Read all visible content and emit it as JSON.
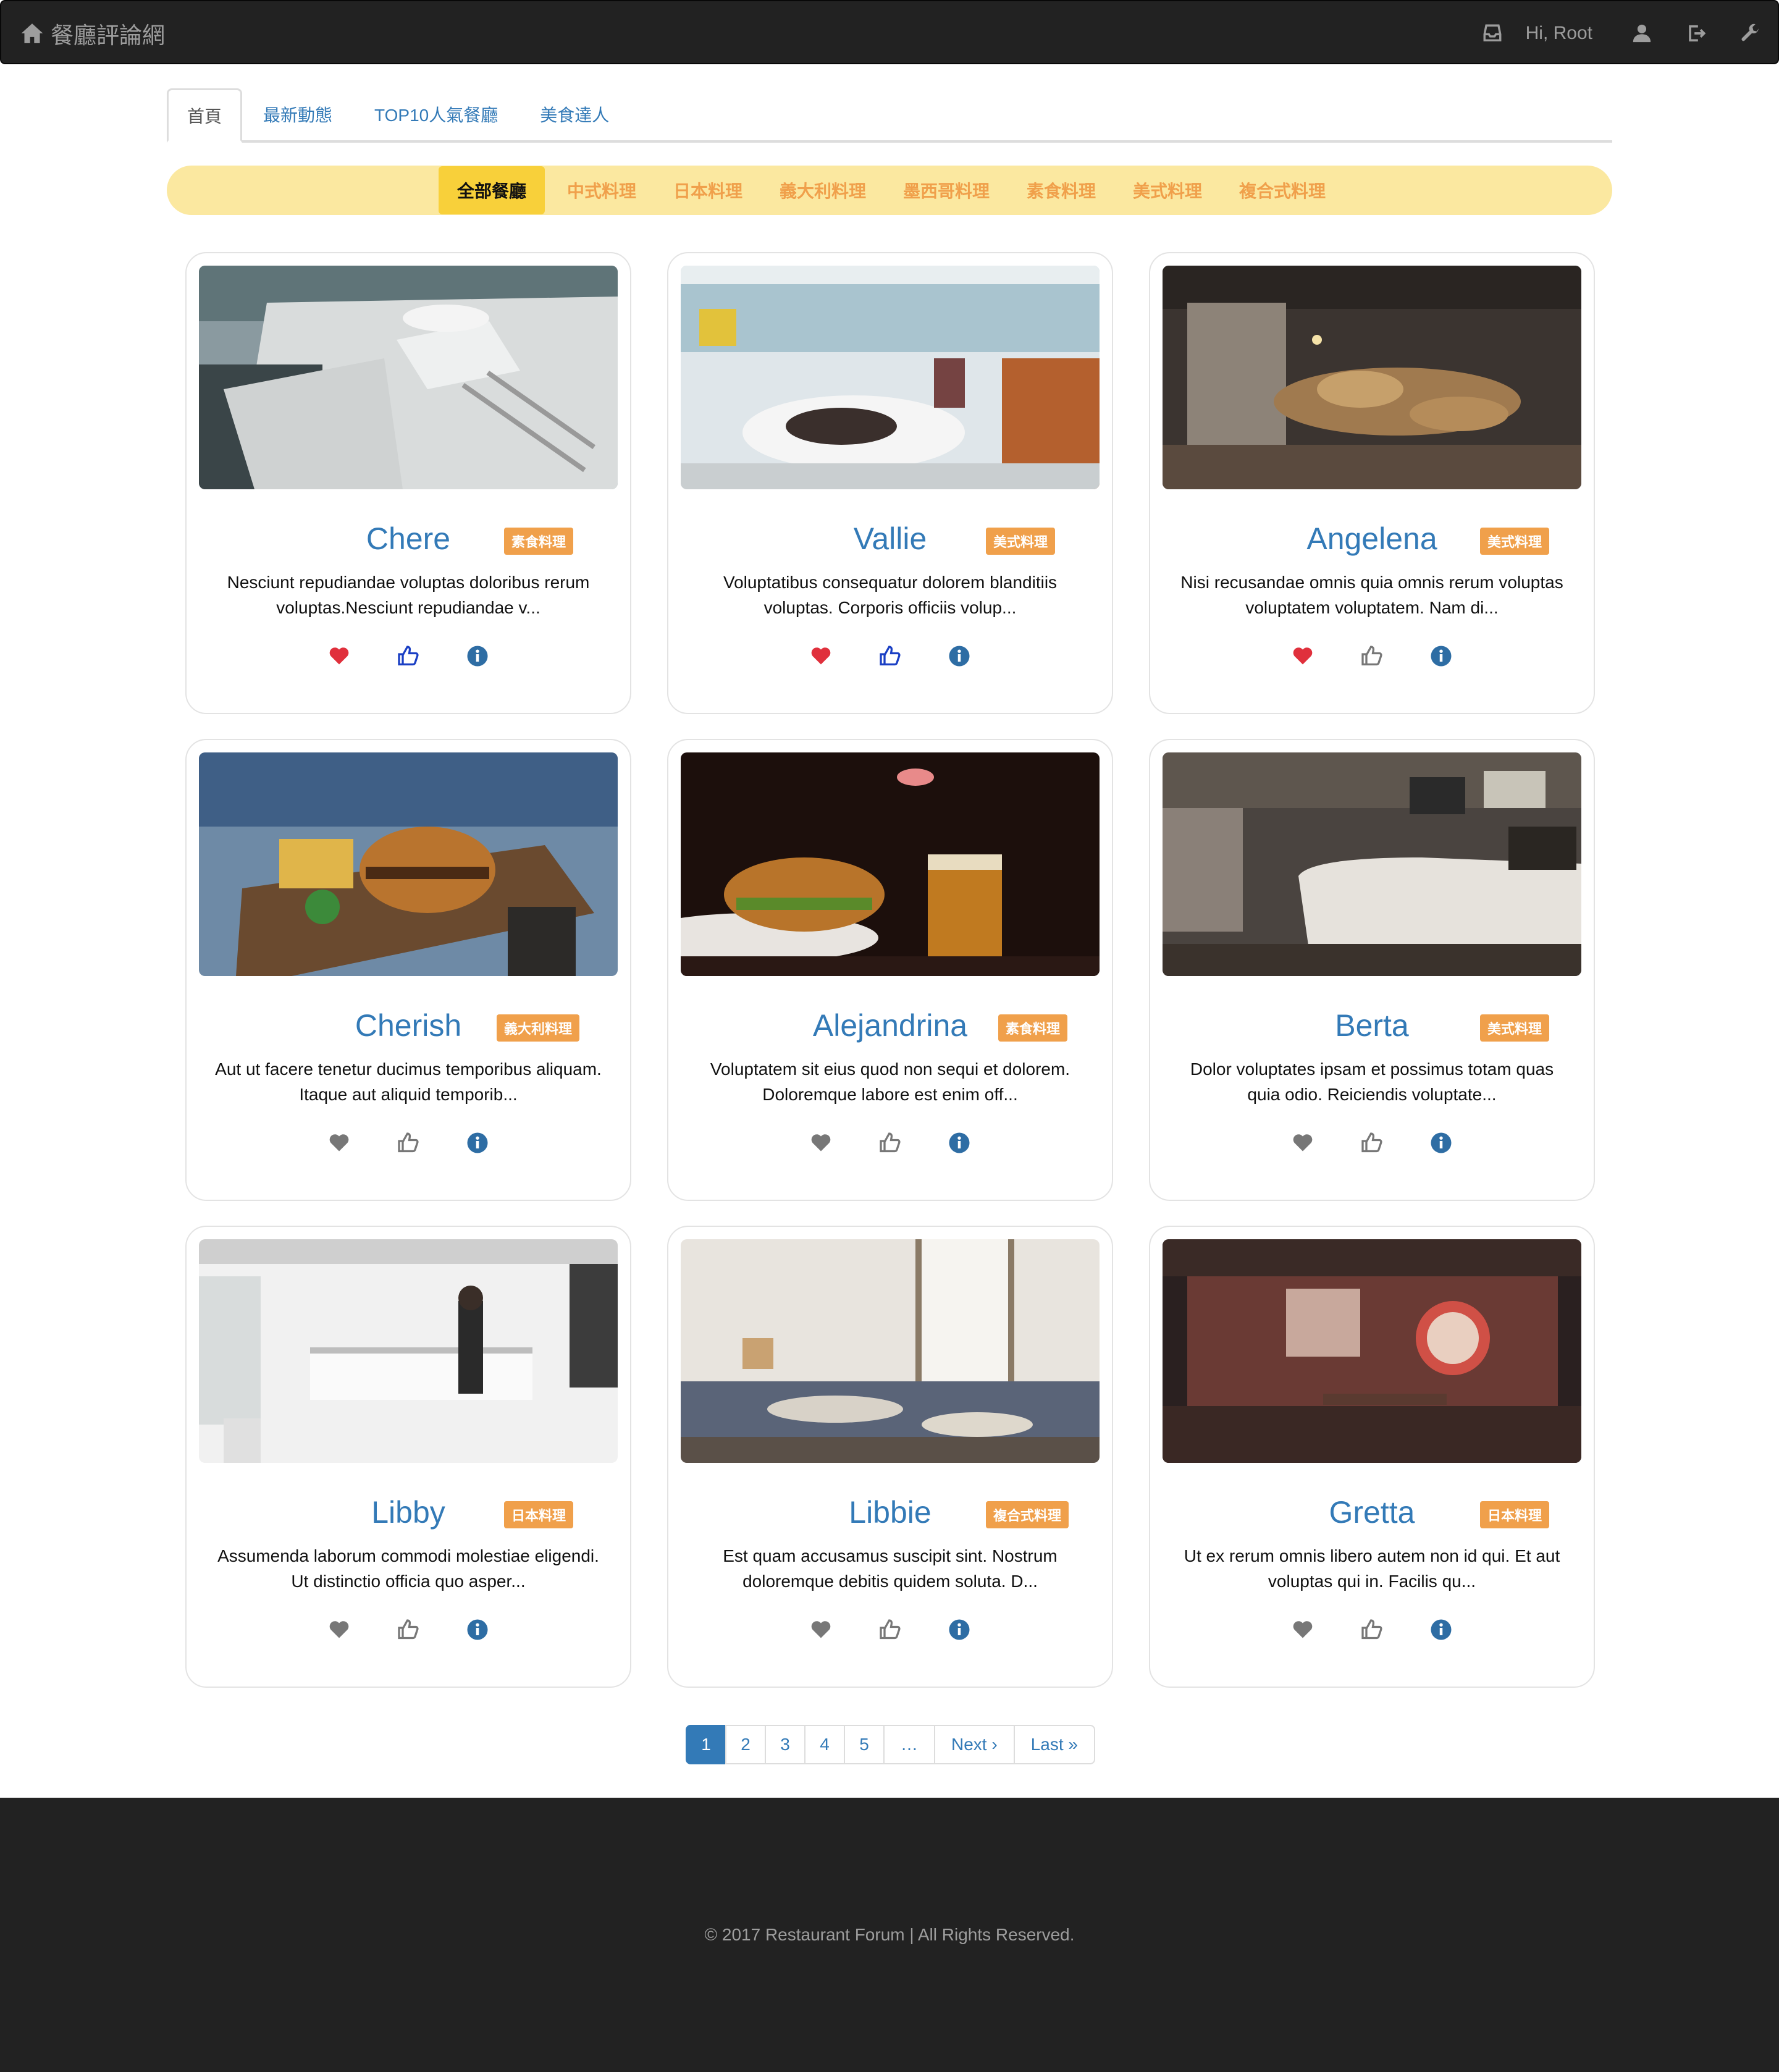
{
  "navbar": {
    "brand": "餐廳評論網",
    "greeting": "Hi, Root"
  },
  "tabs": [
    {
      "label": "首頁",
      "active": true
    },
    {
      "label": "最新動態",
      "active": false
    },
    {
      "label": "TOP10人氣餐廳",
      "active": false
    },
    {
      "label": "美食達人",
      "active": false
    }
  ],
  "categories": [
    {
      "label": "全部餐廳",
      "active": true
    },
    {
      "label": "中式料理",
      "active": false
    },
    {
      "label": "日本料理",
      "active": false
    },
    {
      "label": "義大利料理",
      "active": false
    },
    {
      "label": "墨西哥料理",
      "active": false
    },
    {
      "label": "素食料理",
      "active": false
    },
    {
      "label": "美式料理",
      "active": false
    },
    {
      "label": "複合式料理",
      "active": false
    }
  ],
  "restaurants": [
    {
      "name": "Chere",
      "category": "素食料理",
      "desc_line1": "Nesciunt repudiandae voluptas doloribus rerum",
      "desc_line2": "voluptas.Nesciunt repudiandae v...",
      "favorited": true,
      "liked": true
    },
    {
      "name": "Vallie",
      "category": "美式料理",
      "desc_line1": "Voluptatibus consequatur dolorem blanditiis",
      "desc_line2": "voluptas. Corporis officiis volup...",
      "favorited": true,
      "liked": true
    },
    {
      "name": "Angelena",
      "category": "美式料理",
      "desc_line1": "Nisi recusandae omnis quia omnis rerum voluptas",
      "desc_line2": "voluptatem voluptatem. Nam di...",
      "favorited": true,
      "liked": false
    },
    {
      "name": "Cherish",
      "category": "義大利料理",
      "desc_line1": "Aut ut facere tenetur ducimus temporibus aliquam.",
      "desc_line2": "Itaque aut aliquid temporib...",
      "favorited": false,
      "liked": false
    },
    {
      "name": "Alejandrina",
      "category": "素食料理",
      "desc_line1": "Voluptatem sit eius quod non sequi et dolorem.",
      "desc_line2": "Doloremque labore est enim off...",
      "favorited": false,
      "liked": false
    },
    {
      "name": "Berta",
      "category": "美式料理",
      "desc_line1": "Dolor voluptates ipsam et possimus totam quas",
      "desc_line2": "quia odio. Reiciendis voluptate...",
      "favorited": false,
      "liked": false
    },
    {
      "name": "Libby",
      "category": "日本料理",
      "desc_line1": "Assumenda laborum commodi molestiae eligendi.",
      "desc_line2": "Ut distinctio officia quo asper...",
      "favorited": false,
      "liked": false
    },
    {
      "name": "Libbie",
      "category": "複合式料理",
      "desc_line1": "Est quam accusamus suscipit sint. Nostrum",
      "desc_line2": "doloremque debitis quidem soluta. D...",
      "favorited": false,
      "liked": false
    },
    {
      "name": "Gretta",
      "category": "日本料理",
      "desc_line1": "Ut ex rerum omnis libero autem non id qui. Et aut",
      "desc_line2": "voluptas qui in. Facilis qu...",
      "favorited": false,
      "liked": false
    }
  ],
  "pagination": {
    "pages": [
      "1",
      "2",
      "3",
      "4",
      "5"
    ],
    "current": "1",
    "gap": "…",
    "next": "Next ›",
    "last": "Last »"
  },
  "footer": {
    "copyright": "© 2017 Restaurant Forum | All Rights Reserved."
  },
  "colors": {
    "navbar_bg": "#222222",
    "link": "#337ab7",
    "category_bar": "#fbe8a0",
    "category_active": "#f8d03a",
    "category_text": "#f0a04b",
    "badge": "#f0a04b",
    "heart_active": "#e0303c",
    "like_active": "#1a3fc4",
    "icon_inactive": "#777777"
  }
}
